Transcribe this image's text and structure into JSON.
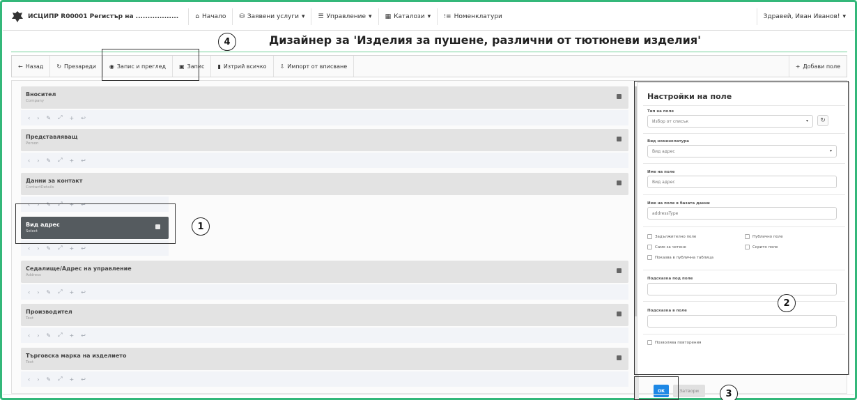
{
  "navbar": {
    "brand": "ИСЦИПР R00001 Регистър на ..................",
    "items": [
      {
        "label": "Начало",
        "icon": "home-icon",
        "dropdown": false
      },
      {
        "label": "Заявени услуги",
        "icon": "database-icon",
        "dropdown": true
      },
      {
        "label": "Управление",
        "icon": "list-icon",
        "dropdown": true
      },
      {
        "label": "Каталози",
        "icon": "table-icon",
        "dropdown": true
      },
      {
        "label": "Номенклатури",
        "icon": "list-icon",
        "dropdown": false
      }
    ],
    "user": "Здравей, Иван Иванов!"
  },
  "page": {
    "title": "Дизайнер за 'Изделия за пушене, различни от тютюневи изделия'"
  },
  "toolbar": {
    "back": "Назад",
    "reload": "Презареди",
    "save_preview": "Запис и преглед",
    "save": "Запис",
    "delete_all": "Изтрий всичко",
    "import": "Импорт от вписване",
    "add_field": "Добави поле"
  },
  "fields": [
    {
      "name": "Вносител",
      "type": "Company"
    },
    {
      "name": "Представляващ",
      "type": "Person"
    },
    {
      "name": "Данни за контакт",
      "type": "ContactDetails"
    },
    {
      "name": "Вид адрес",
      "type": "Select"
    },
    {
      "name": "Седалище/Адрес на управление",
      "type": "Address"
    },
    {
      "name": "Производител",
      "type": "Text"
    },
    {
      "name": "Търговска марка на изделието",
      "type": "Text"
    }
  ],
  "tool_icons": [
    "‹",
    "›",
    "✎",
    "⤢",
    "+",
    "↩"
  ],
  "settings": {
    "title": "Настройки на поле",
    "field_type_label": "Тип на поле",
    "field_type_value": "Избор от списък",
    "nomenclature_label": "Вид номенклатура",
    "nomenclature_value": "Вид адрес",
    "name_label": "Име на поле",
    "name_value": "Вид адрес",
    "db_name_label": "Име на поле в базата данни",
    "db_name_value": "addressType",
    "checkboxes": {
      "required": "Задължително поле",
      "public": "Публично поле",
      "readonly": "Само за четене",
      "hidden": "Скрито поле",
      "show_public_table": "Показва в публична таблица"
    },
    "hint_label": "Подсказка под поле",
    "hint_in_label": "Подсказка в поле",
    "allow_repeat": "Позволява повторения",
    "ok": "ОК",
    "close": "Затвори"
  },
  "annotations": [
    "1",
    "2",
    "3",
    "4"
  ],
  "colors": {
    "accent": "#1e88e5",
    "border_green": "#34b87a",
    "selected_field": "#555b5f"
  }
}
